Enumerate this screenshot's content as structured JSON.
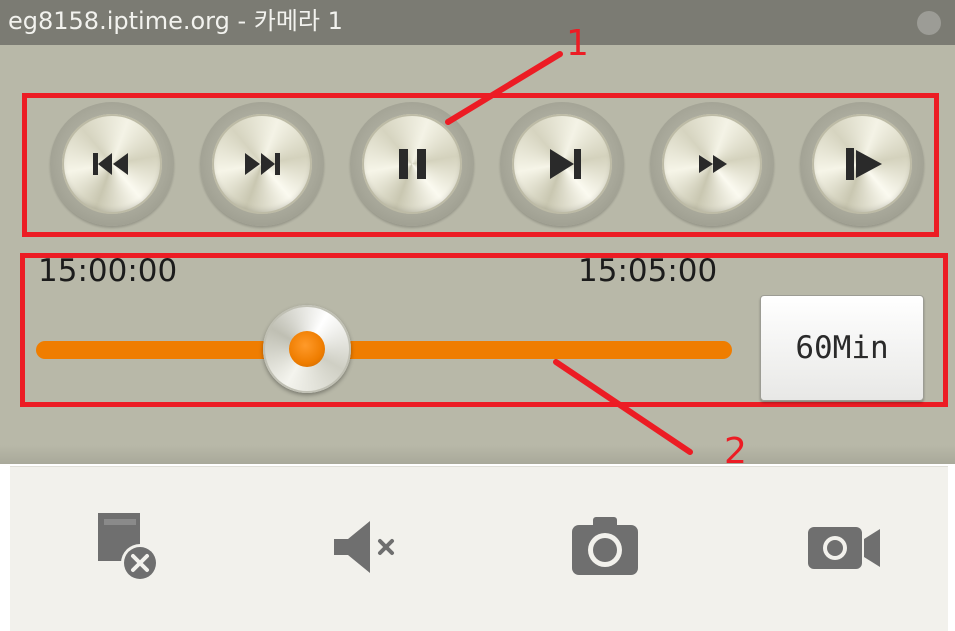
{
  "window": {
    "title": "eg8158.iptime.org - 카메라 1"
  },
  "annotations": {
    "label_1": "1",
    "label_2": "2",
    "color": "#ec1c24"
  },
  "playback_controls": [
    {
      "name": "skip-to-start",
      "icon": "skip-back-icon"
    },
    {
      "name": "skip-to-end",
      "icon": "skip-forward-icon"
    },
    {
      "name": "pause",
      "icon": "pause-icon"
    },
    {
      "name": "step-forward",
      "icon": "step-forward-icon"
    },
    {
      "name": "fast-forward",
      "icon": "fast-forward-icon"
    },
    {
      "name": "slow-play",
      "icon": "slow-play-icon"
    }
  ],
  "timeline": {
    "start_time": "15:00:00",
    "end_time": "15:05:00",
    "position_fraction": 0.39,
    "track_color": "#ef7d00",
    "range_button_label": "60Min"
  },
  "toolbar": [
    {
      "name": "close-video",
      "icon": "close-video-icon"
    },
    {
      "name": "mute",
      "icon": "mute-icon"
    },
    {
      "name": "snapshot",
      "icon": "camera-icon"
    },
    {
      "name": "record",
      "icon": "video-record-icon"
    }
  ],
  "colors": {
    "player_background": "#b8b8a8",
    "toolbar_background": "#f2f1ec",
    "icon_gray": "#6f6f6f"
  }
}
